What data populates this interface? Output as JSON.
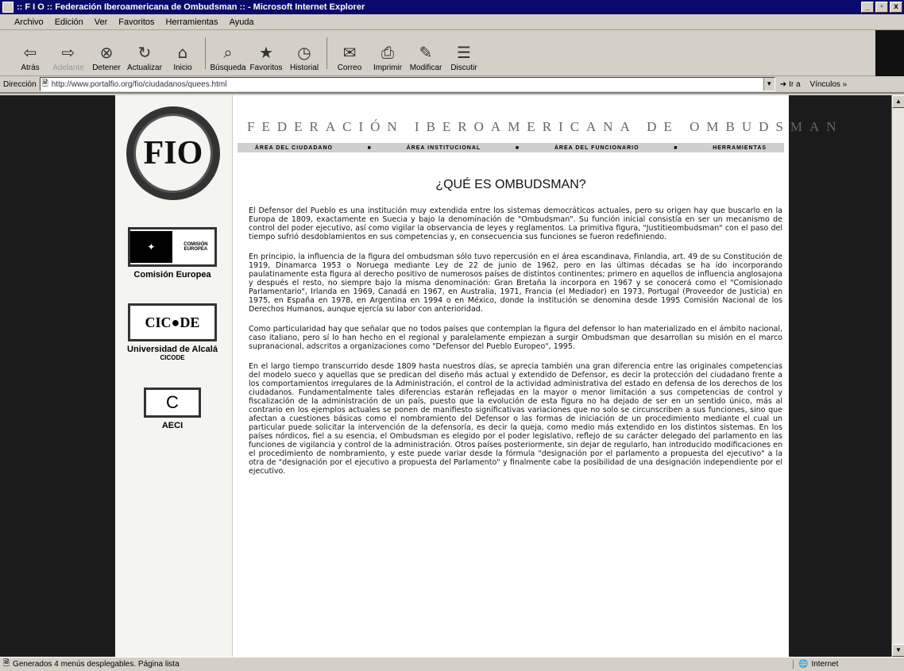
{
  "window": {
    "title": ":: F I O :: Federación Iberoamericana de Ombudsman :: - Microsoft Internet Explorer",
    "min": "_",
    "max": "▫",
    "close": "x"
  },
  "menu": [
    "Archivo",
    "Edición",
    "Ver",
    "Favoritos",
    "Herramientas",
    "Ayuda"
  ],
  "toolbar": [
    {
      "label": "Atrás",
      "icon": "back-arrow-icon",
      "glyph": "⇦"
    },
    {
      "label": "Adelante",
      "icon": "forward-arrow-icon",
      "glyph": "⇨"
    },
    {
      "label": "Detener",
      "icon": "stop-icon",
      "glyph": "⊗"
    },
    {
      "label": "Actualizar",
      "icon": "refresh-icon",
      "glyph": "↻"
    },
    {
      "label": "Inicio",
      "icon": "home-icon",
      "glyph": "⌂"
    },
    {
      "label": "Búsqueda",
      "icon": "search-icon",
      "glyph": "⌕"
    },
    {
      "label": "Favoritos",
      "icon": "favorites-icon",
      "glyph": "★"
    },
    {
      "label": "Historial",
      "icon": "history-icon",
      "glyph": "◷"
    },
    {
      "label": "Correo",
      "icon": "mail-icon",
      "glyph": "✉"
    },
    {
      "label": "Imprimir",
      "icon": "print-icon",
      "glyph": "⎙"
    },
    {
      "label": "Modificar",
      "icon": "edit-icon",
      "glyph": "✎"
    },
    {
      "label": "Discutir",
      "icon": "discuss-icon",
      "glyph": "☰"
    }
  ],
  "address": {
    "label": "Dirección",
    "url": "http://www.portalfio.org/fio/ciudadanos/quees.html",
    "go": "Ir a",
    "links": "Vínculos »"
  },
  "sidebar": {
    "seal_text": "FIO",
    "sponsors": [
      {
        "caption": "Comisión Europea",
        "subcaption": "",
        "logo_text": "COMISIÓN EUROPEA"
      },
      {
        "caption": "Universidad de Alcalá",
        "subcaption": "CICODE",
        "logo_text": "CIC●DE"
      },
      {
        "caption": "AECI",
        "subcaption": "",
        "logo_text": "C"
      }
    ]
  },
  "header": {
    "title": "FEDERACIÓN IBEROAMERICANA DE OMBUDSMAN"
  },
  "nav": [
    "ÁREA DEL CIUDADANO",
    "ÁREA INSTITUCIONAL",
    "ÁREA DEL FUNCIONARIO",
    "HERRAMIENTAS"
  ],
  "nav_sep": "■",
  "main": {
    "title": "¿QUÉ ES OMBUDSMAN?",
    "paragraphs": [
      "El Defensor del Pueblo es una institución muy extendida entre los sistemas democráticos actuales, pero su origen hay que buscarlo en la Europa de 1809, exactamente en Suecia y bajo la denominación de \"Ombudsman\". Su función inicial consistía en ser un mecanismo de control del poder ejecutivo, así como vigilar la observancia de leyes y reglamentos. La primitiva figura, \"Justitieombudsman\" con el paso del tiempo sufrió desdoblamientos en sus competencias y, en consecuencia sus funciones se fueron redefiniendo.",
      "En principio, la influencia de la figura del ombudsman sólo tuvo repercusión en el área escandinava, Finlandia, art. 49 de su Constitución de 1919, Dinamarca 1953 o Noruega mediante Ley de 22 de junio de 1962, pero en las últimas décadas se ha ido incorporando paulatinamente esta figura al derecho positivo de numerosos países de distintos continentes; primero en aquellos de influencia anglosajona y después el resto, no siempre bajo la misma denominación: Gran Bretaña la incorpora en 1967 y se conocerá como el \"Comisionado Parlamentario\", Irlanda en 1969, Canadá en 1967, en Australia, 1971, Francia (el Mediador) en 1973, Portugal (Proveedor de Justicia) en 1975, en España en 1978, en Argentina en 1994 o en México, donde la institución se denomina desde 1995 Comisión Nacional de los Derechos Humanos, aunque ejercía su labor con anterioridad.",
      "Como particularidad hay que señalar que no todos países que contemplan la figura del defensor lo han materializado en el ámbito nacional, caso italiano, pero sí lo han hecho en el regional y paralelamente empiezan a surgir Ombudsman que desarrollan su misión en el marco supranacional, adscritos a organizaciones como \"Defensor del Pueblo Europeo\", 1995.",
      "En el largo tiempo transcurrido desde 1809 hasta nuestros días, se aprecia también una gran diferencia entre las originales competencias del modelo sueco y aquellas que se predican del diseño más actual y extendido de Defensor, es decir la protección del ciudadano frente a los comportamientos irregulares de la Administración, el control de la actividad administrativa del estado en defensa de los derechos de los ciudadanos. Fundamentalmente tales diferencias estarán reflejadas en la mayor o menor limitación a sus competencias de control y fiscalización de la administración de un país, puesto que la evolución de esta figura no ha dejado de ser en un sentido único, más al contrario en los ejemplos actuales se ponen de manifiesto significativas variaciones que no solo se circunscriben a sus funciones, sino que afectan a cuestiones básicas como el nombramiento del Defensor o las formas de iniciación de un procedimiento mediante el cual un particular puede solicitar la intervención de la defensoría, es decir la queja, como medio más extendido en los distintos sistemas. En los países nórdicos, fiel a su esencia, el Ombudsman es elegido por el poder legislativo, reflejo de su carácter delegado del parlamento en las funciones de vigilancia y control de la administración. Otros países posteriormente, sin dejar de regularlo, han introducido modificaciones en el procedimiento de nombramiento, y este puede variar desde la fórmula \"designación por el parlamento a propuesta del ejecutivo\" a la otra de \"designación por el ejecutivo a propuesta del Parlamento\" y finalmente cabe la posibilidad de una designación independiente por el ejecutivo."
    ]
  },
  "status": {
    "text": "Generados 4 menús desplegables. Página lista",
    "zone": "Internet"
  }
}
